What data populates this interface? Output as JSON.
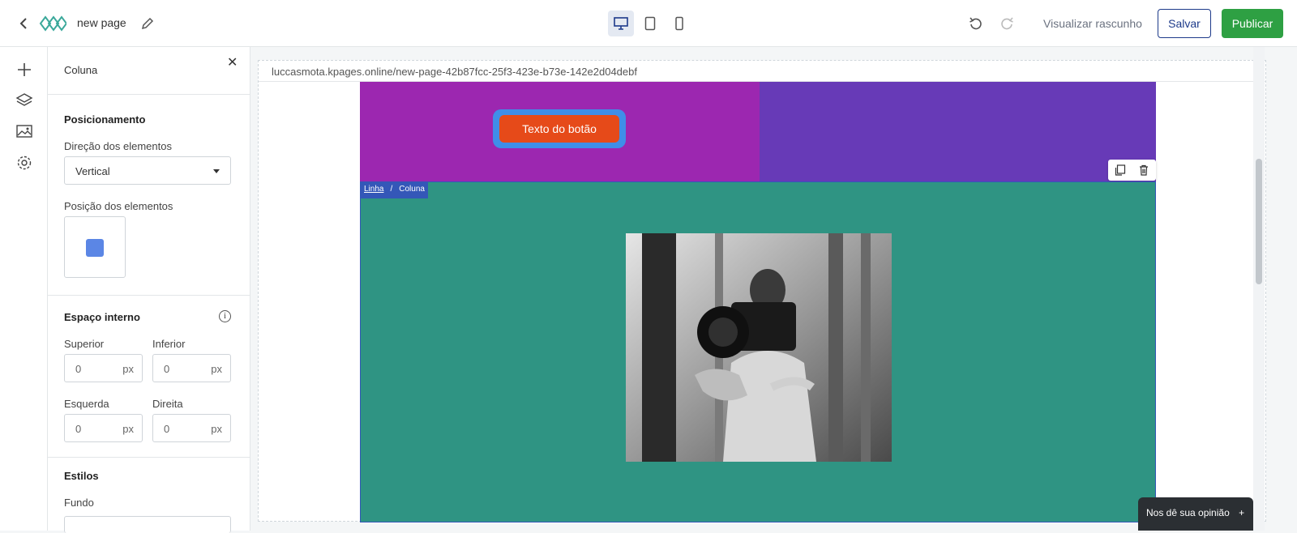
{
  "header": {
    "page_name": "new page",
    "devices": [
      "desktop",
      "tablet",
      "mobile"
    ],
    "active_device": "desktop",
    "preview_label": "Visualizar rascunho",
    "save_label": "Salvar",
    "publish_label": "Publicar",
    "colors": {
      "publish": "#2ea043",
      "save": "#1d3a8a"
    }
  },
  "rail": {
    "icons": [
      "plus-icon",
      "layers-icon",
      "image-icon",
      "gear-icon"
    ]
  },
  "panel": {
    "title": "Coluna",
    "positioning": {
      "title": "Posicionamento",
      "direction_label": "Direção dos elementos",
      "direction_value": "Vertical",
      "position_label": "Posição dos elementos"
    },
    "padding": {
      "title": "Espaço interno",
      "top_label": "Superior",
      "bottom_label": "Inferior",
      "left_label": "Esquerda",
      "right_label": "Direita",
      "top_value": "0",
      "bottom_value": "0",
      "left_value": "0",
      "right_value": "0",
      "unit": "px"
    },
    "styles": {
      "title": "Estilos",
      "background_label": "Fundo"
    }
  },
  "canvas": {
    "url": "luccasmota.kpages.online/new-page-42b87fcc-25f3-423e-b73e-142e2d04debf",
    "button_text": "Texto do botão",
    "breadcrumb": {
      "row": "Linha",
      "sep": "/",
      "column": "Coluna"
    },
    "colors": {
      "col1": "#9c27b0",
      "col2": "#673ab7",
      "row2": "#2f9483",
      "button": "#e64a19"
    }
  },
  "feedback": {
    "label": "Nos dê sua opinião",
    "plus": "+"
  }
}
